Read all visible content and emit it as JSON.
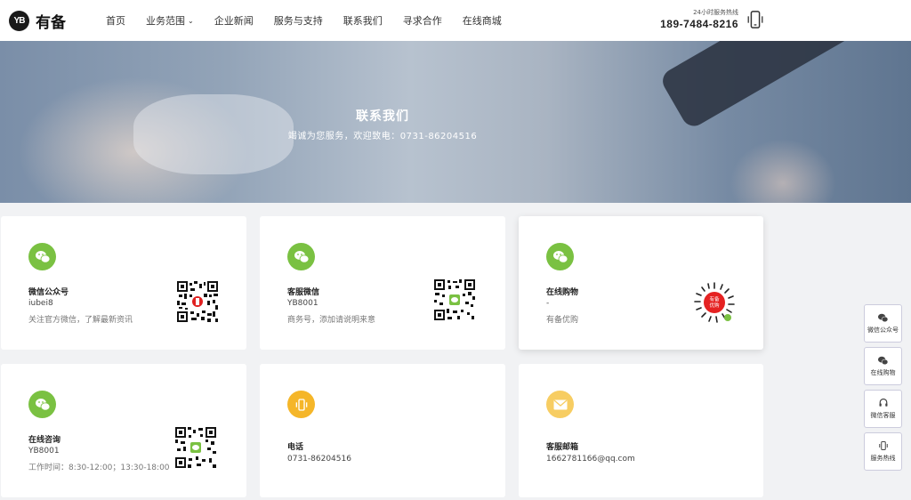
{
  "header": {
    "logo_mark": "YB",
    "logo_text": "有备",
    "nav": [
      "首页",
      "业务范围",
      "企业新闻",
      "服务与支持",
      "联系我们",
      "寻求合作",
      "在线商城"
    ],
    "hotline_label": "24小时服务热线",
    "hotline_number": "189-7484-8216"
  },
  "banner": {
    "title": "联系我们",
    "subtitle": "竭诚为您服务，欢迎致电：0731-86204516"
  },
  "cards": [
    {
      "title": "微信公众号",
      "value": "iubei8",
      "desc": "关注官方微信，了解最新资讯",
      "icon": "wechat-icon",
      "color": "#7ac142"
    },
    {
      "title": "客服微信",
      "value": "YB8001",
      "desc": "商务号，添加请说明来意",
      "icon": "wechat-icon",
      "color": "#7ac142"
    },
    {
      "title": "在线购物",
      "value": "-",
      "desc": "有备优购",
      "icon": "wechat-icon",
      "color": "#7ac142",
      "mini_program_label": "有备优购"
    },
    {
      "title": "在线咨询",
      "value": "YB8001",
      "desc": "工作时间：8:30-12:00；13:30-18:00",
      "icon": "wechat-icon",
      "color": "#7ac142"
    },
    {
      "title": "电话",
      "value": "0731-86204516",
      "icon": "phone-icon",
      "color": "#f5b629"
    },
    {
      "title": "客服邮箱",
      "value": "1662781166@qq.com",
      "icon": "mail-icon",
      "color": "#f7cd62"
    }
  ],
  "sidebar": [
    {
      "label": "微信公众号",
      "icon": "wechat-icon"
    },
    {
      "label": "在线购物",
      "icon": "wechat-icon"
    },
    {
      "label": "微信客服",
      "icon": "headset-icon"
    },
    {
      "label": "服务热线",
      "icon": "phone-icon"
    }
  ]
}
